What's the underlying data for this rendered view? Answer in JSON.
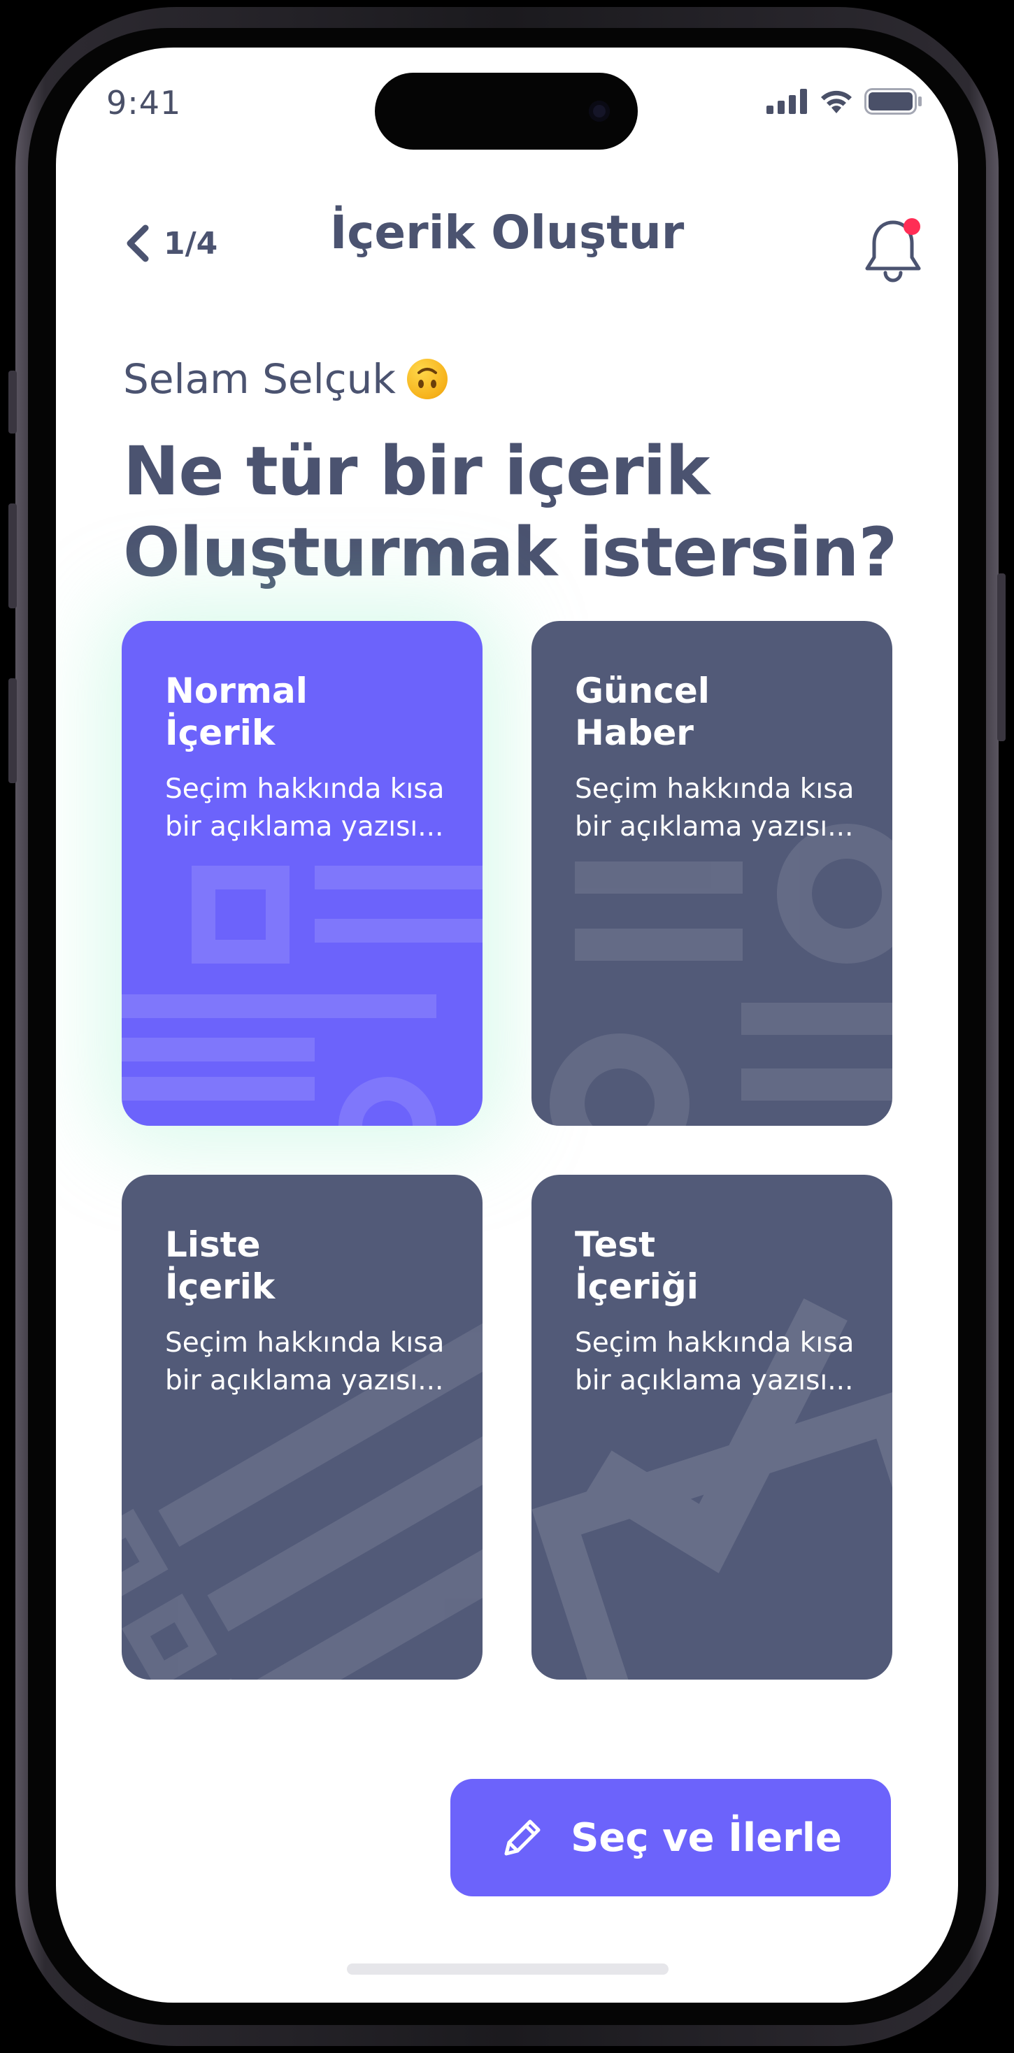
{
  "status_bar": {
    "time": "9:41"
  },
  "nav": {
    "step": "1/4",
    "title": "İçerik Oluştur",
    "notification_badge_color": "#ff2d55"
  },
  "greeting": {
    "text": "Selam Selçuk",
    "emoji": "upside-down-face"
  },
  "headline": {
    "line1": "Ne tür bir içerik",
    "line2": "Oluşturmak istersin?"
  },
  "options": [
    {
      "title_line1": "Normal",
      "title_line2": "İçerik",
      "description": "Seçim hakkında kısa bir açıklama yazısı...",
      "selected": true
    },
    {
      "title_line1": "Güncel",
      "title_line2": "Haber",
      "description": "Seçim hakkında kısa bir açıklama yazısı...",
      "selected": false
    },
    {
      "title_line1": "Liste",
      "title_line2": "İçerik",
      "description": "Seçim hakkında kısa bir açıklama yazısı...",
      "selected": false
    },
    {
      "title_line1": "Test",
      "title_line2": "İçeriği",
      "description": "Seçim hakkında kısa bir açıklama yazısı...",
      "selected": false
    }
  ],
  "cta": {
    "label": "Seç ve İlerle",
    "icon": "pencil-icon"
  },
  "colors": {
    "accent": "#6c63fb",
    "card": "#525a78",
    "text": "#4b5370"
  }
}
